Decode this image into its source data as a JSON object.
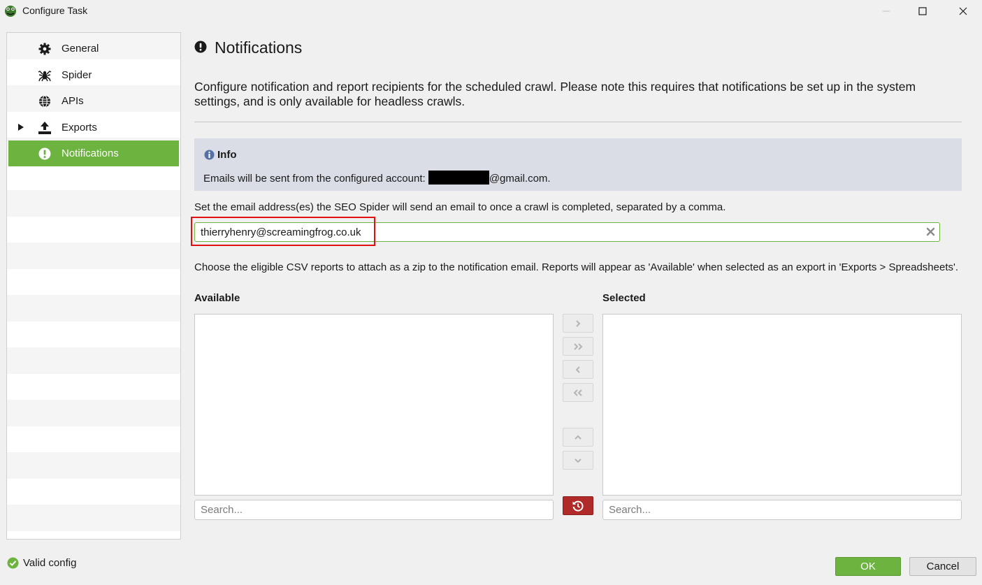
{
  "window": {
    "title": "Configure Task"
  },
  "sidebar": {
    "items": [
      {
        "label": "General",
        "icon": "gear-icon"
      },
      {
        "label": "Spider",
        "icon": "spider-icon"
      },
      {
        "label": "APIs",
        "icon": "globe-icon"
      },
      {
        "label": "Exports",
        "icon": "upload-icon",
        "expandable": true
      },
      {
        "label": "Notifications",
        "icon": "exclamation-circle-icon",
        "selected": true
      }
    ]
  },
  "main": {
    "title": "Notifications",
    "description": "Configure notification and report recipients for the scheduled crawl. Please note this requires that notifications be set up in the system settings, and is only available for headless crawls.",
    "info": {
      "title": "Info",
      "text_prefix": "Emails will be sent from the configured account: ",
      "text_suffix": "@gmail.com."
    },
    "email_label": "Set the email address(es) the SEO Spider will send an email to once a crawl is completed, separated by a comma.",
    "email_value": "thierryhenry@screamingfrog.co.uk",
    "reports_label": "Choose the eligible CSV reports to attach as a zip to the notification email. Reports will appear as 'Available' when selected as an export in 'Exports > Spreadsheets'.",
    "available_label": "Available",
    "selected_label": "Selected",
    "search_placeholder": "Search...",
    "available_items": [],
    "selected_items": []
  },
  "footer": {
    "status": "Valid config",
    "ok_label": "OK",
    "cancel_label": "Cancel"
  },
  "colors": {
    "accent": "#6db33f",
    "info_bg": "#dadde6",
    "reset": "#b02a2a",
    "highlight": "#e01010"
  }
}
